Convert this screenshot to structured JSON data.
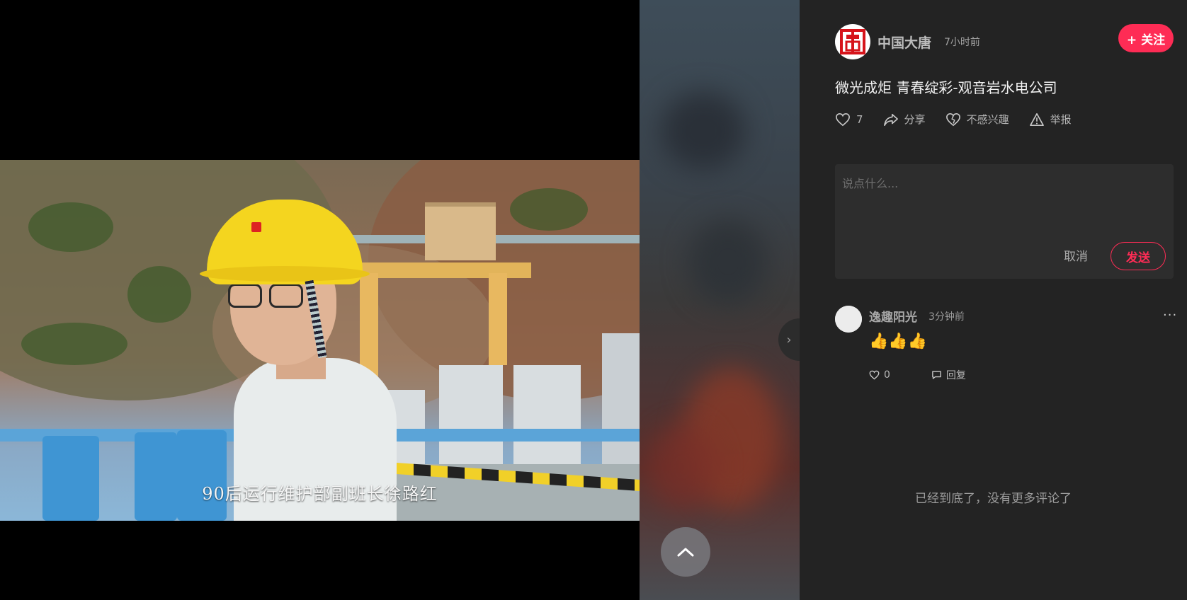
{
  "video": {
    "subtitle": "90后运行维护部副班长徐路红"
  },
  "author": {
    "name": "中国大唐",
    "time": "7小时前",
    "follow_label": "+ 关注"
  },
  "post": {
    "title": "微光成炬 青春绽彩-观音岩水电公司"
  },
  "actions": {
    "like_count": "7",
    "share_label": "分享",
    "not_interested_label": "不感兴趣",
    "report_label": "举报"
  },
  "comment_box": {
    "placeholder": "说点什么...",
    "cancel_label": "取消",
    "send_label": "发送"
  },
  "comments": [
    {
      "user": "逸趣阳光",
      "time": "3分钟前",
      "content": "👍👍👍",
      "like_count": "0",
      "reply_label": "回复",
      "more": "..."
    }
  ],
  "end_note": "已经到底了，没有更多评论了",
  "collapse_glyph": "›",
  "colors": {
    "accent": "#fe2c55",
    "panel_bg": "#232323",
    "input_bg": "#2d2d2d"
  },
  "icons": [
    "heart-icon",
    "share-icon",
    "broken-heart-icon",
    "warning-icon",
    "comment-icon",
    "chevron-up-icon",
    "chevron-right-icon"
  ]
}
